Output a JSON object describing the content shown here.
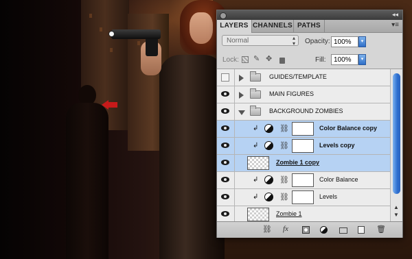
{
  "panel": {
    "tabs": [
      {
        "label": "LAYERS"
      },
      {
        "label": "CHANNELS"
      },
      {
        "label": "PATHS"
      }
    ],
    "blend_mode": "Normal",
    "opacity_label": "Opacity:",
    "opacity_value": "100%",
    "lock_label": "Lock:",
    "fill_label": "Fill:",
    "fill_value": "100%",
    "collapse_glyph": "◂◂",
    "menu_glyph": "▾≡"
  },
  "layers": [
    {
      "name": "GUIDES/TEMPLATE",
      "type": "group",
      "visible": false,
      "expanded": false,
      "selected": false
    },
    {
      "name": "MAIN FIGURES",
      "type": "group",
      "visible": true,
      "expanded": false,
      "selected": false
    },
    {
      "name": "BACKGROUND ZOMBIES",
      "type": "group",
      "visible": true,
      "expanded": true,
      "selected": false
    },
    {
      "name": "Color Balance copy",
      "type": "adjustment",
      "visible": true,
      "selected": true
    },
    {
      "name": "Levels copy",
      "type": "adjustment",
      "visible": true,
      "selected": true
    },
    {
      "name": "Zombie 1 copy",
      "type": "pixel",
      "visible": true,
      "selected": true
    },
    {
      "name": "Color Balance",
      "type": "adjustment",
      "visible": true,
      "selected": false
    },
    {
      "name": "Levels",
      "type": "adjustment",
      "visible": true,
      "selected": false
    },
    {
      "name": "Zombie 1",
      "type": "pixel",
      "visible": true,
      "selected": false
    }
  ],
  "bottom_icons": [
    "link-icon",
    "fx-icon",
    "mask-icon",
    "adjustment-icon",
    "new-group-icon",
    "new-layer-icon",
    "trash-icon"
  ],
  "colors": {
    "selection": "#b6d2f3",
    "accent_blue": "#2d6ed0",
    "arrow_red": "#c81a1a"
  }
}
